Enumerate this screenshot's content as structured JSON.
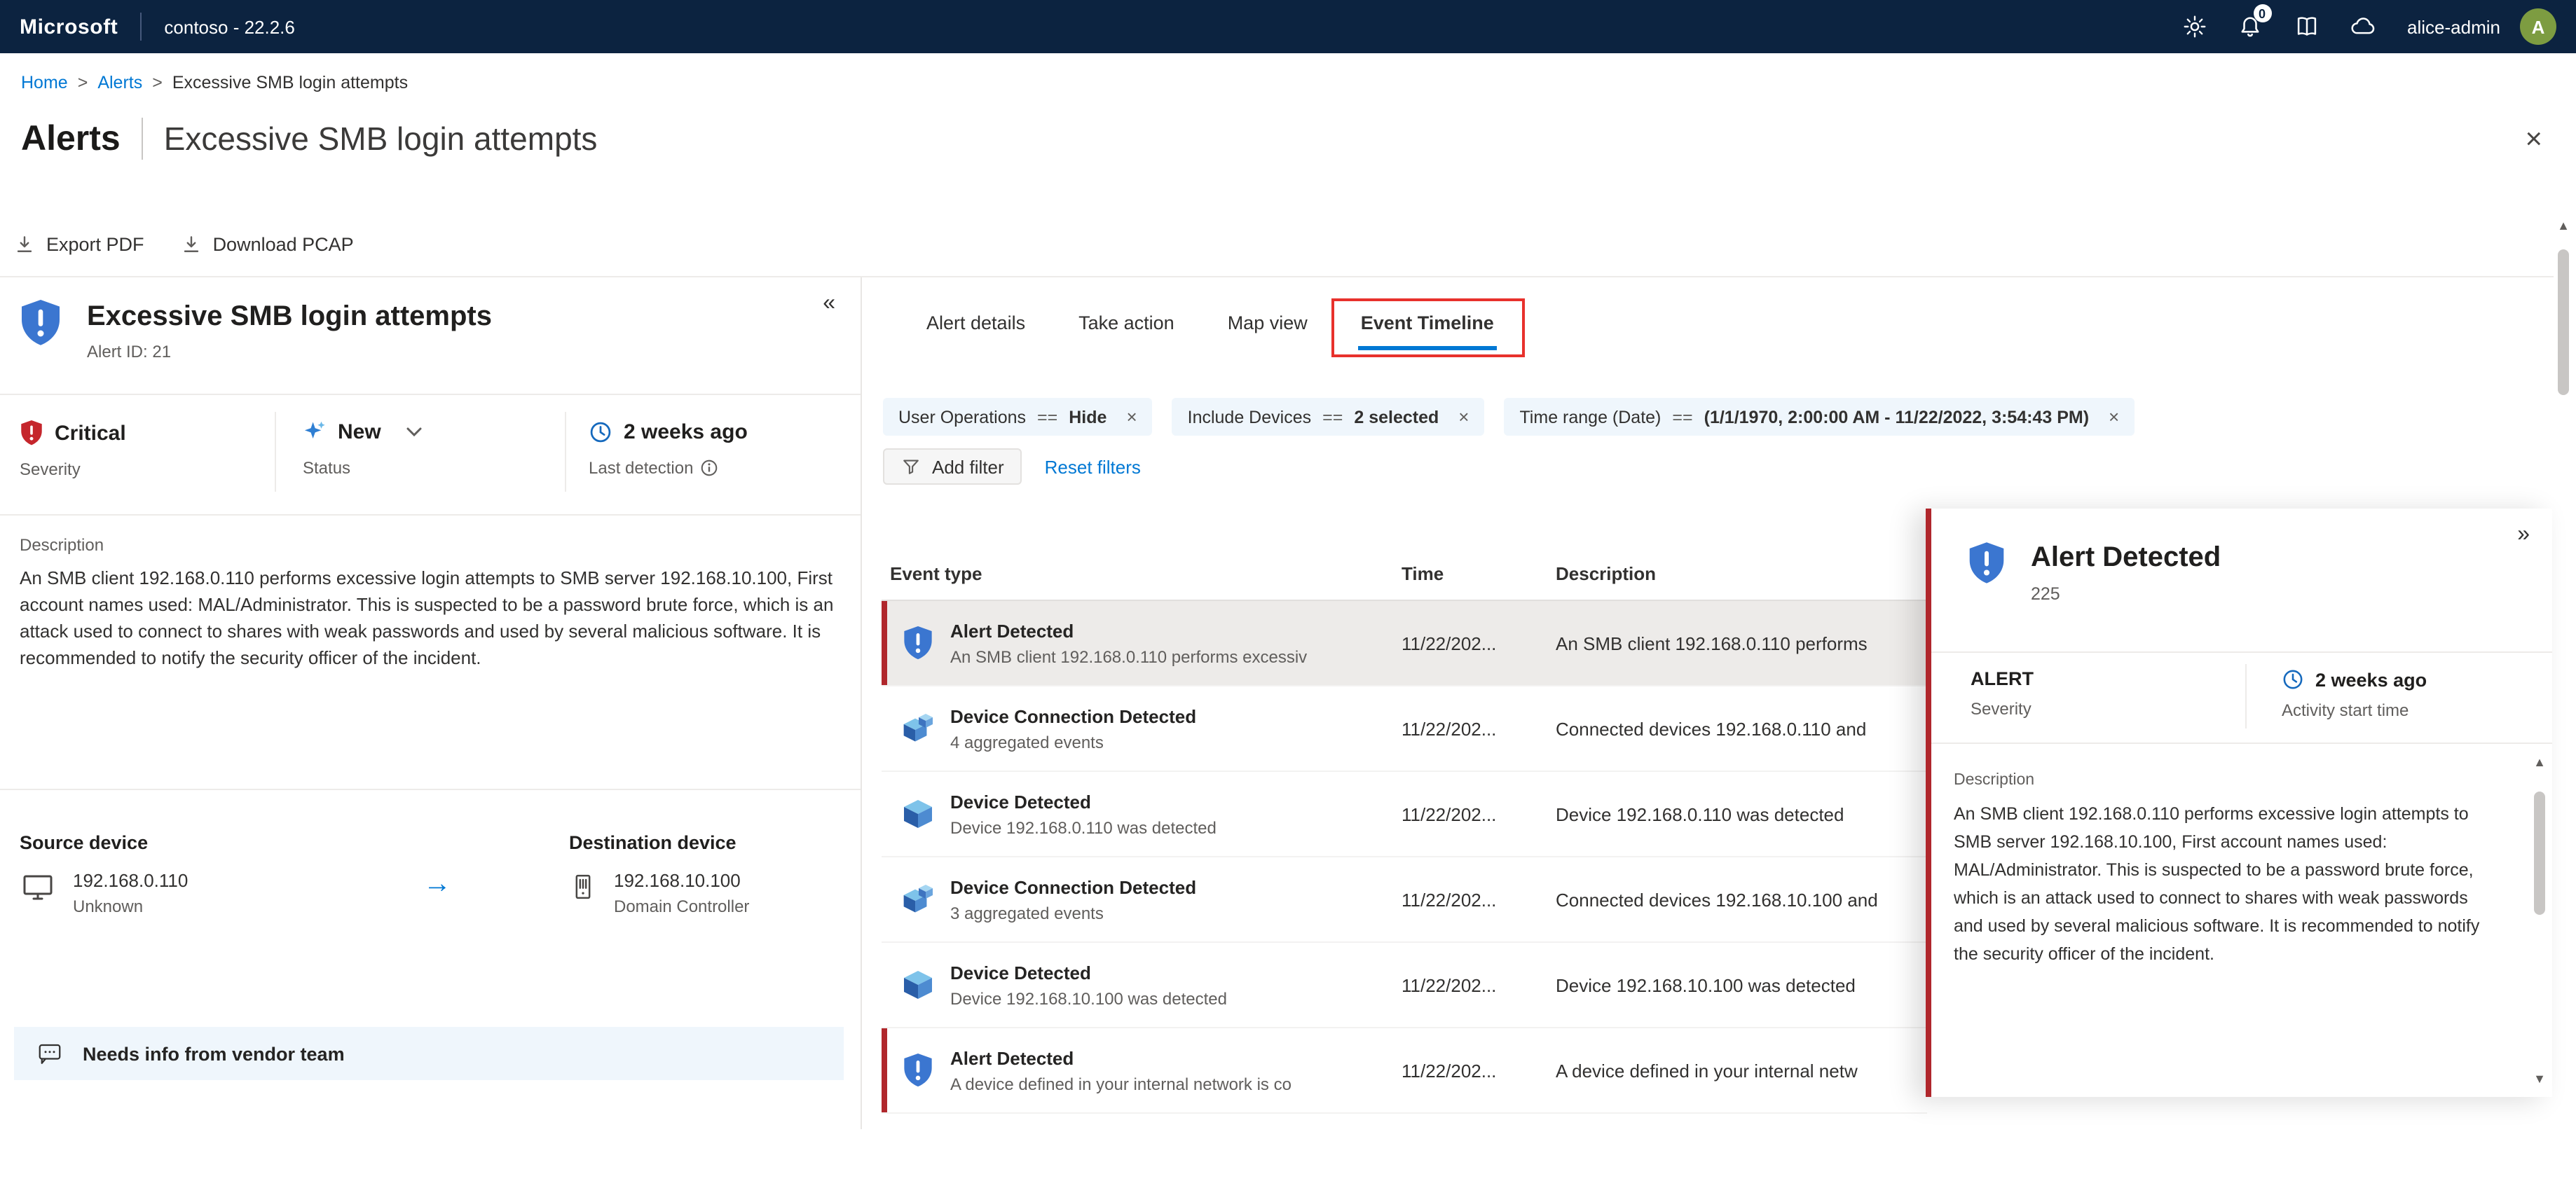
{
  "colors": {
    "accent": "#0078d4",
    "topbar_bg": "#0c2340",
    "severity_red": "#b0272c",
    "alert_blue": "#3b76d0",
    "pill_bg": "#eff6fc",
    "selected_row_bg": "#edebe9",
    "annotation_red": "#e8312c"
  },
  "icons": {
    "collapse_panel": "«",
    "expand_panel": "»",
    "close_page": "×",
    "remove_filter": "×",
    "arrow_right": "→",
    "scroll_up": "▲",
    "scroll_down": "▼"
  },
  "topbar": {
    "brand": "Microsoft",
    "environment": "contoso - 22.2.6",
    "notification_badge": "0",
    "user_name": "alice-admin",
    "avatar_initial": "A"
  },
  "breadcrumb": {
    "home": "Home",
    "alerts": "Alerts",
    "separator": ">",
    "current": "Excessive SMB login attempts"
  },
  "page": {
    "title": "Alerts",
    "subtitle": "Excessive SMB login attempts"
  },
  "command_bar": {
    "export_pdf": "Export PDF",
    "download_pcap": "Download PCAP"
  },
  "alert_panel": {
    "title": "Excessive SMB login attempts",
    "alert_id": "Alert ID: 21",
    "severity_value": "Critical",
    "severity_label": "Severity",
    "status_value": "New",
    "status_label": "Status",
    "detection_value": "2 weeks ago",
    "detection_label": "Last detection",
    "description_label": "Description",
    "description": "An SMB client 192.168.0.110 performs excessive login attempts to SMB server 192.168.10.100, First account names used: MAL/Administrator. This is suspected to be a password brute force, which is an attack used to connect to shares with weak passwords and used by several malicious software. It is recommended to notify the security officer of the incident.",
    "source_label": "Source device",
    "source_ip": "192.168.0.110",
    "source_type": "Unknown",
    "dest_label": "Destination device",
    "dest_ip": "192.168.10.100",
    "dest_type": "Domain Controller",
    "banner": "Needs info from vendor team"
  },
  "tabs": [
    {
      "label": "Alert details",
      "selected": false,
      "highlighted": false
    },
    {
      "label": "Take action",
      "selected": false,
      "highlighted": false
    },
    {
      "label": "Map view",
      "selected": false,
      "highlighted": false
    },
    {
      "label": "Event Timeline",
      "selected": true,
      "highlighted": true
    }
  ],
  "filters": {
    "pills": [
      {
        "name": "User Operations",
        "op": "==",
        "value": "Hide"
      },
      {
        "name": "Include Devices",
        "op": "==",
        "value": "2 selected"
      },
      {
        "name": "Time range (Date)",
        "op": "==",
        "value": "(1/1/1970, 2:00:00 AM - 11/22/2022, 3:54:43 PM)"
      }
    ],
    "add_filter": "Add filter",
    "reset_filters": "Reset filters"
  },
  "event_table": {
    "columns": [
      "Event type",
      "Time",
      "Description"
    ],
    "rows": [
      {
        "icon": "alert",
        "title": "Alert Detected",
        "subtitle": "An SMB client 192.168.0.110 performs excessiv",
        "time": "11/22/202...",
        "description": "An SMB client 192.168.0.110 performs",
        "selected": true,
        "severity_bar": true
      },
      {
        "icon": "device-connection",
        "title": "Device Connection Detected",
        "subtitle": "4 aggregated events",
        "time": "11/22/202...",
        "description": "Connected devices 192.168.0.110 and",
        "selected": false,
        "severity_bar": false
      },
      {
        "icon": "device",
        "title": "Device Detected",
        "subtitle": "Device 192.168.0.110 was detected",
        "time": "11/22/202...",
        "description": "Device 192.168.0.110 was detected",
        "selected": false,
        "severity_bar": false
      },
      {
        "icon": "device-connection",
        "title": "Device Connection Detected",
        "subtitle": "3 aggregated events",
        "time": "11/22/202...",
        "description": "Connected devices 192.168.10.100 and",
        "selected": false,
        "severity_bar": false
      },
      {
        "icon": "device",
        "title": "Device Detected",
        "subtitle": "Device 192.168.10.100 was detected",
        "time": "11/22/202...",
        "description": "Device 192.168.10.100 was detected",
        "selected": false,
        "severity_bar": false
      },
      {
        "icon": "alert",
        "title": "Alert Detected",
        "subtitle": "A device defined in your internal network is co",
        "time": "11/22/202...",
        "description": "A device defined in your internal netw",
        "selected": false,
        "severity_bar": true
      }
    ]
  },
  "detail_panel": {
    "title": "Alert Detected",
    "event_id": "225",
    "severity_value": "ALERT",
    "severity_label": "Severity",
    "time_value": "2 weeks ago",
    "time_label": "Activity start time",
    "description_label": "Description",
    "description": "An SMB client 192.168.0.110 performs excessive login attempts to SMB server 192.168.10.100, First account names used: MAL/Administrator. This is suspected to be a password brute force, which is an attack used to connect to shares with weak passwords and used by several malicious software. It is recommended to notify the security officer of the incident."
  }
}
